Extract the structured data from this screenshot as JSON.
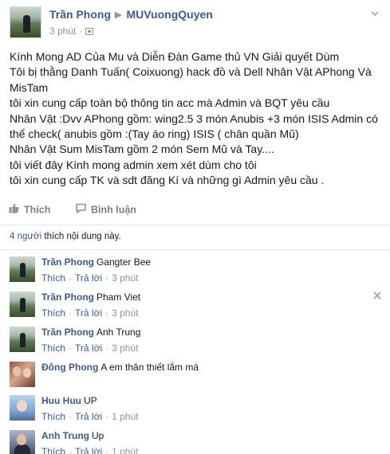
{
  "post": {
    "author": "Trần Phong",
    "target": "MUVuongQuyen",
    "time": "3 phút",
    "body_lines": [
      "Kính Mong AD Của Mu và Diễn Đàn Game thủ VN Giải quyết Dùm",
      "Tôi bị thằng Danh Tuấn( Coixuong) hack đồ và Dell Nhân Vật APhong Và MisTam",
      "tôi xin cung cấp toàn bộ thông tin acc mà Admin và BQT yêu cầu",
      "Nhân Vật :Dvv APhong gồm: wing2.5 3 món Anubis +3 món ISIS Admin có thể check( anubis gồm :(Tay áo ring) ISIS ( chân quần Mũ)",
      "Nhân Vật Sum MisTam gồm 2 món Sem Mũ và Tay....",
      "tôi viết đây Kính mong admin xem xét dùm cho tôi",
      "tôi xin cung cấp TK và sdt đăng Kí và những gì Admin yêu cầu ."
    ]
  },
  "actions": {
    "like_label": "Thích",
    "comment_label": "Bình luận"
  },
  "likes": {
    "count": "4 người",
    "text": " thích nội dung này."
  },
  "comment_meta": {
    "like_label": "Thích",
    "reply_label": "Trả lời",
    "separator": "·"
  },
  "comments": [
    {
      "author": "Trần Phong",
      "message": "Gangter Bee",
      "time": "3 phút"
    },
    {
      "author": "Trần Phong",
      "message": "Pham Viet",
      "time": "3 phút"
    },
    {
      "author": "Trần Phong",
      "message": "Anh Trung",
      "time": "3 phút"
    },
    {
      "author": "Đông Phong",
      "message": "A em thân thiết lắm mà",
      "time": ""
    },
    {
      "author": "Huu Huu",
      "message": "UP",
      "time": "1 phút"
    },
    {
      "author": "Anh Trung",
      "message": "Up",
      "time": "1 phút"
    }
  ],
  "colors": {
    "link": "#3b5998",
    "meta": "#90949c",
    "text": "#141823"
  },
  "icons": {
    "header_menu": "chevron-down-icon",
    "privacy": "privacy-icon",
    "like": "thumbs-up-icon",
    "comment": "comment-bubble-icon",
    "remove_comment": "close-icon"
  }
}
